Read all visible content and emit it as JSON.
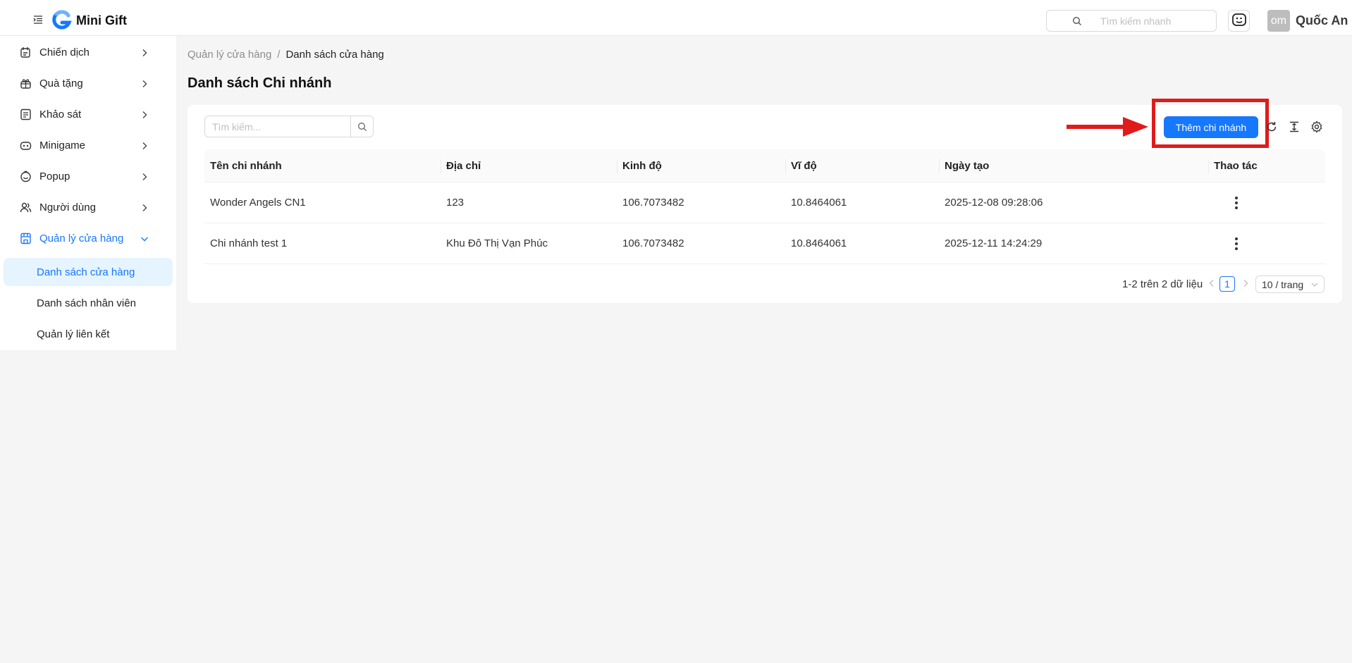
{
  "header": {
    "app_name": "Mini Gift",
    "search_placeholder": "Tìm kiếm nhanh",
    "avatar_initials": "om",
    "user_name": "Quốc An"
  },
  "sidebar": {
    "items": [
      {
        "label": "Chiến dịch",
        "icon": "campaign-icon"
      },
      {
        "label": "Quà tặng",
        "icon": "gift-icon"
      },
      {
        "label": "Khảo sát",
        "icon": "survey-icon"
      },
      {
        "label": "Minigame",
        "icon": "game-icon"
      },
      {
        "label": "Popup",
        "icon": "popup-icon"
      },
      {
        "label": "Người dùng",
        "icon": "users-icon"
      },
      {
        "label": "Quản lý cửa hàng",
        "icon": "store-icon"
      }
    ],
    "sub_items": [
      {
        "label": "Danh sách cửa hàng",
        "active": true
      },
      {
        "label": "Danh sách nhân viên",
        "active": false
      },
      {
        "label": "Quản lý liên kết",
        "active": false
      }
    ]
  },
  "breadcrumb": {
    "parent": "Quản lý cửa hàng",
    "separator": "/",
    "current": "Danh sách cửa hàng"
  },
  "page_title": "Danh sách Chi nhánh",
  "toolbar": {
    "search_placeholder": "Tìm kiếm...",
    "add_button": "Thêm chi nhánh"
  },
  "table": {
    "columns": [
      "Tên chi nhánh",
      "Địa chỉ",
      "Kinh độ",
      "Vĩ độ",
      "Ngày tạo",
      "Thao tác"
    ],
    "rows": [
      {
        "name": "Wonder Angels CN1",
        "address": "123",
        "longitude": "106.7073482",
        "latitude": "10.8464061",
        "created": "2025-12-08 09:28:06"
      },
      {
        "name": "Chi nhánh test 1",
        "address": "Khu Đô Thị Vạn Phúc",
        "longitude": "106.7073482",
        "latitude": "10.8464061",
        "created": "2025-12-11 14:24:29"
      }
    ]
  },
  "pagination": {
    "total_text": "1-2 trên 2 dữ liệu",
    "current_page": "1",
    "page_size": "10 / trang"
  },
  "colors": {
    "primary": "#1677ff",
    "annotation": "#e01b1b"
  }
}
